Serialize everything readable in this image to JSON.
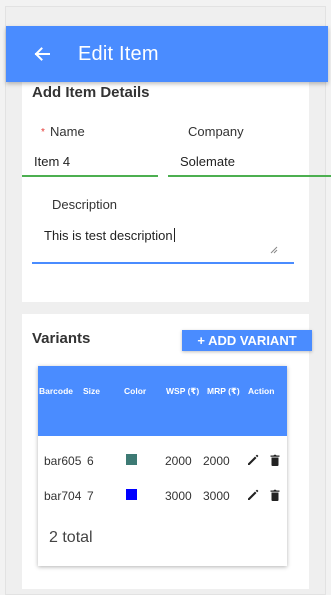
{
  "appbar": {
    "title": "Edit Item",
    "back_icon": "arrow-left-icon",
    "color": "#4a8cff"
  },
  "details": {
    "title": "Add Item Details",
    "name": {
      "label": "Name",
      "required_mark": "*",
      "value": "Item 4"
    },
    "company": {
      "label": "Company",
      "value": "Solemate"
    },
    "description": {
      "label": "Description",
      "value": "This is test description"
    }
  },
  "variants": {
    "title": "Variants",
    "add_button": "+ ADD VARIANT",
    "columns": [
      "Barcode",
      "Size",
      "Color",
      "WSP (₹)",
      "MRP (₹)",
      "Action"
    ],
    "rows": [
      {
        "barcode": "bar605",
        "size": "6",
        "color": "#3d7a74",
        "wsp": "2000",
        "mrp": "2000"
      },
      {
        "barcode": "bar704",
        "size": "7",
        "color": "#0000ff",
        "wsp": "3000",
        "mrp": "3000"
      }
    ],
    "total": "2 total"
  },
  "colors": {
    "accent": "#4a8cff",
    "valid_underline": "#4caf50",
    "required": "#e53935"
  }
}
